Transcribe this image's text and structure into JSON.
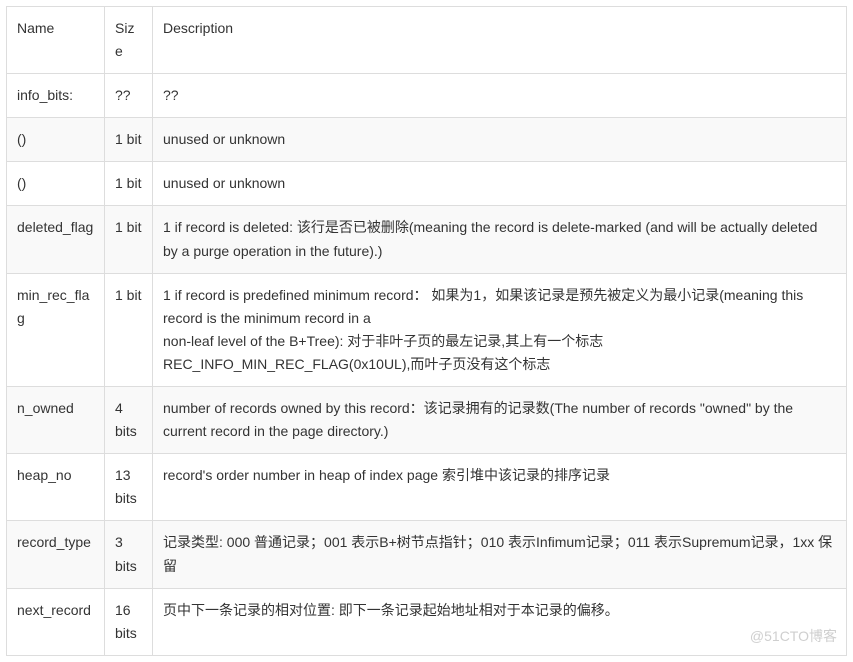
{
  "table": {
    "headers": {
      "name": "Name",
      "size": "Size",
      "description": "Description"
    },
    "rows": [
      {
        "name": "info_bits:",
        "size": "??",
        "description": "??"
      },
      {
        "name": "()",
        "size": "1 bit",
        "description": "unused or unknown"
      },
      {
        "name": "()",
        "size": "1 bit",
        "description": "unused or unknown"
      },
      {
        "name": "deleted_flag",
        "size": "1 bit",
        "description": "1 if record is deleted:   该行是否已被删除(meaning the record is delete-marked (and will be actually deleted by a purge operation in the future).)"
      },
      {
        "name": "min_rec_flag",
        "size": "1 bit",
        "description": "1 if record is predefined minimum record：  如果为1，如果该记录是预先被定义为最小记录(meaning this record is the minimum record in a\nnon-leaf level of the B+Tree): 对于非叶子页的最左记录,其上有一个标志REC_INFO_MIN_REC_FLAG(0x10UL),而叶子页没有这个标志"
      },
      {
        "name": "n_owned",
        "size": "4 bits",
        "description": "number of records owned by this record：该记录拥有的记录数(The number of records \"owned\" by the current record in the page directory.)"
      },
      {
        "name": "heap_no",
        "size": "13 bits",
        "description": "record's order number in heap of index page 索引堆中该记录的排序记录"
      },
      {
        "name": "record_type",
        "size": "3 bits",
        "description": "记录类型: 000 普通记录；001 表示B+树节点指针；010 表示Infimum记录；011 表示Supremum记录，1xx 保留"
      },
      {
        "name": "next_record",
        "size": "16 bits",
        "description": "页中下一条记录的相对位置: 即下一条记录起始地址相对于本记录的偏移。"
      }
    ]
  },
  "watermark": "@51CTO博客"
}
